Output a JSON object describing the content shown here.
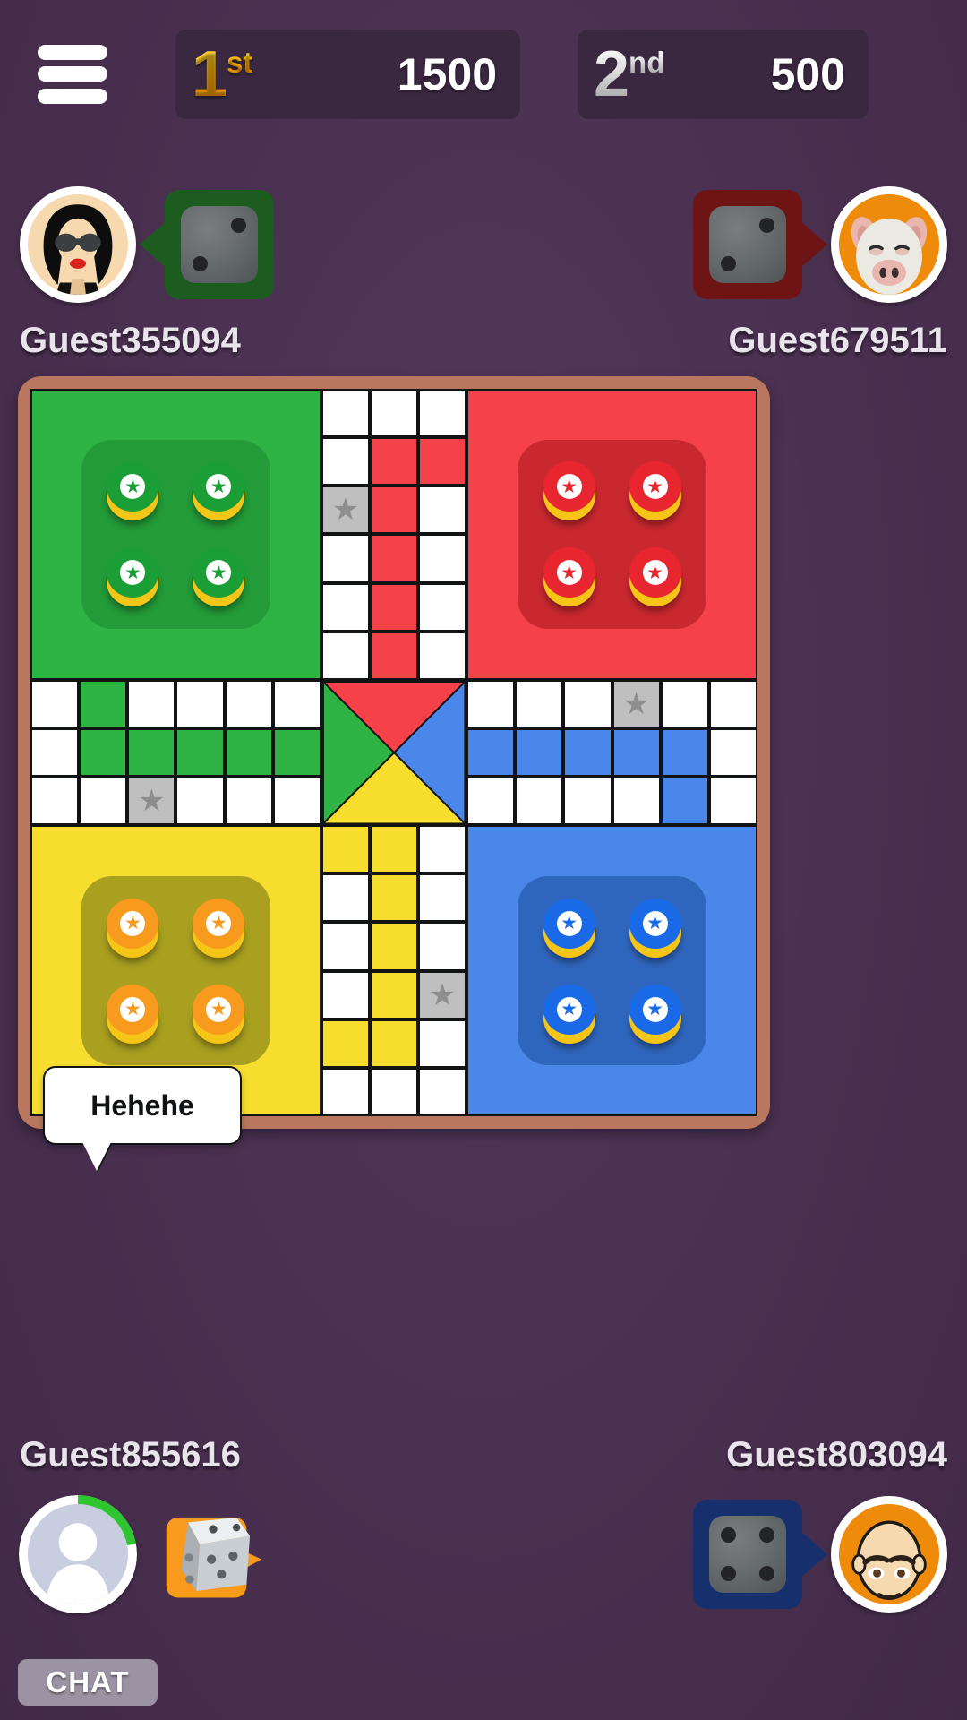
{
  "topbar": {
    "menu_icon": "hamburger-menu-icon",
    "prizes": [
      {
        "rank_num": "1",
        "rank_suffix": "st",
        "amount": "1500",
        "color": "#ffb600"
      },
      {
        "rank_num": "2",
        "rank_suffix": "nd",
        "amount": "500",
        "color": "#dedede"
      }
    ]
  },
  "players": [
    {
      "name": "Guest355094",
      "color_name": "green",
      "color": "#2fb344",
      "avatar_icon": "woman-sunglasses-avatar-icon",
      "dice_value": 2,
      "dice_style": "dark",
      "holder_color": "#1d5c1f",
      "active": false,
      "position": "top-left"
    },
    {
      "name": "Guest679511",
      "color_name": "red",
      "color": "#f5414a",
      "avatar_icon": "pig-face-avatar-icon",
      "dice_value": 2,
      "dice_style": "dark",
      "holder_color": "#6e1414",
      "active": false,
      "position": "top-right"
    },
    {
      "name": "Guest855616",
      "color_name": "yellow",
      "color": "#f7de2e",
      "avatar_icon": "default-person-avatar-icon",
      "dice_value": 5,
      "dice_style": "white-3d",
      "holder_color": "#f79a1d",
      "active": true,
      "turn_timer_percent": 22,
      "position": "bottom-left"
    },
    {
      "name": "Guest803094",
      "color_name": "blue",
      "color": "#4a87e8",
      "avatar_icon": "bald-man-avatar-icon",
      "dice_value": 4,
      "dice_style": "dark",
      "holder_color": "#16306e",
      "active": false,
      "position": "bottom-right"
    }
  ],
  "chat": {
    "bubble_message": "Hehehe",
    "bubble_owner": "Guest855616",
    "button_label": "CHAT"
  },
  "board": {
    "frame_color": "#b9775f",
    "star_icon": "safe-cell-star-icon",
    "token_icon": "star-token-icon",
    "quadrants": [
      {
        "color_name": "green",
        "color": "#2fb344",
        "pad_color": "#239b38",
        "tokens_at_home": 4
      },
      {
        "color_name": "red",
        "color": "#f5414a",
        "pad_color": "#c9282f",
        "tokens_at_home": 4
      },
      {
        "color_name": "yellow",
        "color": "#f7de2e",
        "pad_color": "#a9a020",
        "tokens_at_home": 4
      },
      {
        "color_name": "blue",
        "color": "#4a87e8",
        "pad_color": "#2f66bd",
        "tokens_at_home": 4
      }
    ],
    "center_triangles": {
      "top": "#f5414a",
      "left": "#2fb344",
      "bottom": "#f7de2e",
      "right": "#4a87e8"
    }
  }
}
